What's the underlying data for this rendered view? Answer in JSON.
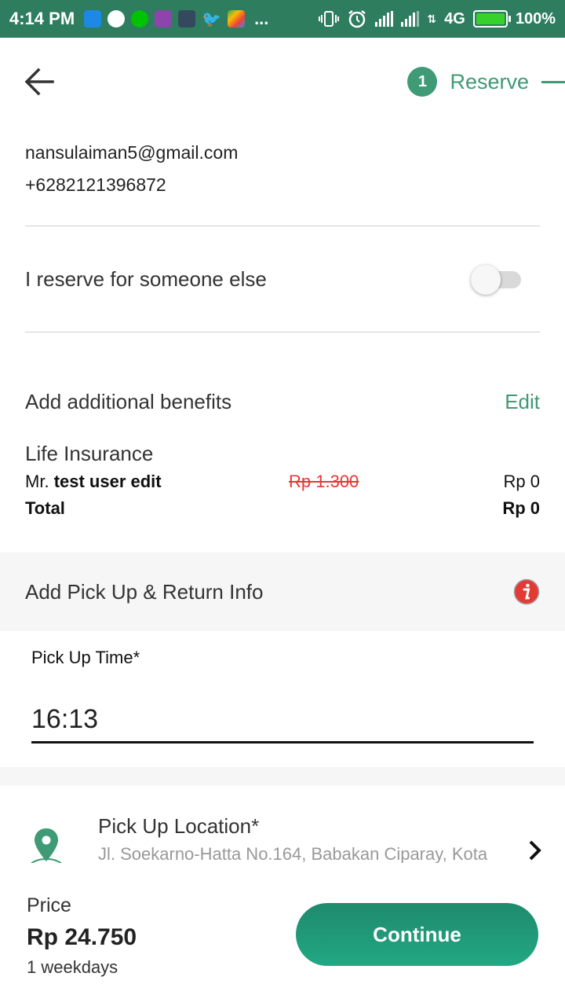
{
  "status_bar": {
    "time": "4:14 PM",
    "overflow": "...",
    "network": "4G",
    "battery": "100%",
    "notification_icons": [
      "bluetooth-alert-icon",
      "messenger-icon",
      "line-icon",
      "notification-icon",
      "game-icon",
      "twitter-icon",
      "play-store-icon"
    ]
  },
  "header": {
    "step_number": "1",
    "step_label": "Reserve"
  },
  "contact": {
    "email": "nansulaiman5@gmail.com",
    "phone": "+6282121396872"
  },
  "reserve_other": {
    "label": "I reserve for someone else",
    "enabled": false
  },
  "benefits": {
    "title": "Add additional benefits",
    "edit_label": "Edit",
    "insurance_title": "Life Insurance",
    "person_prefix": "Mr.",
    "person_name": "test user edit",
    "original_price": "Rp 1.300",
    "price": "Rp 0",
    "total_label": "Total",
    "total_value": "Rp 0"
  },
  "pickup": {
    "section_title": "Add Pick Up & Return Info",
    "time_label": "Pick Up Time*",
    "time_value": "16:13",
    "location_label": "Pick Up Location*",
    "location_value": "Jl. Soekarno-Hatta No.164, Babakan Ciparay, Kota"
  },
  "footer": {
    "price_label": "Price",
    "price_value": "Rp 24.750",
    "duration": "1 weekdays",
    "continue_label": "Continue"
  },
  "colors": {
    "status_bar": "#2e7d5f",
    "accent": "#3f9a76",
    "button": "#1f9a78",
    "strike": "#e53935"
  }
}
